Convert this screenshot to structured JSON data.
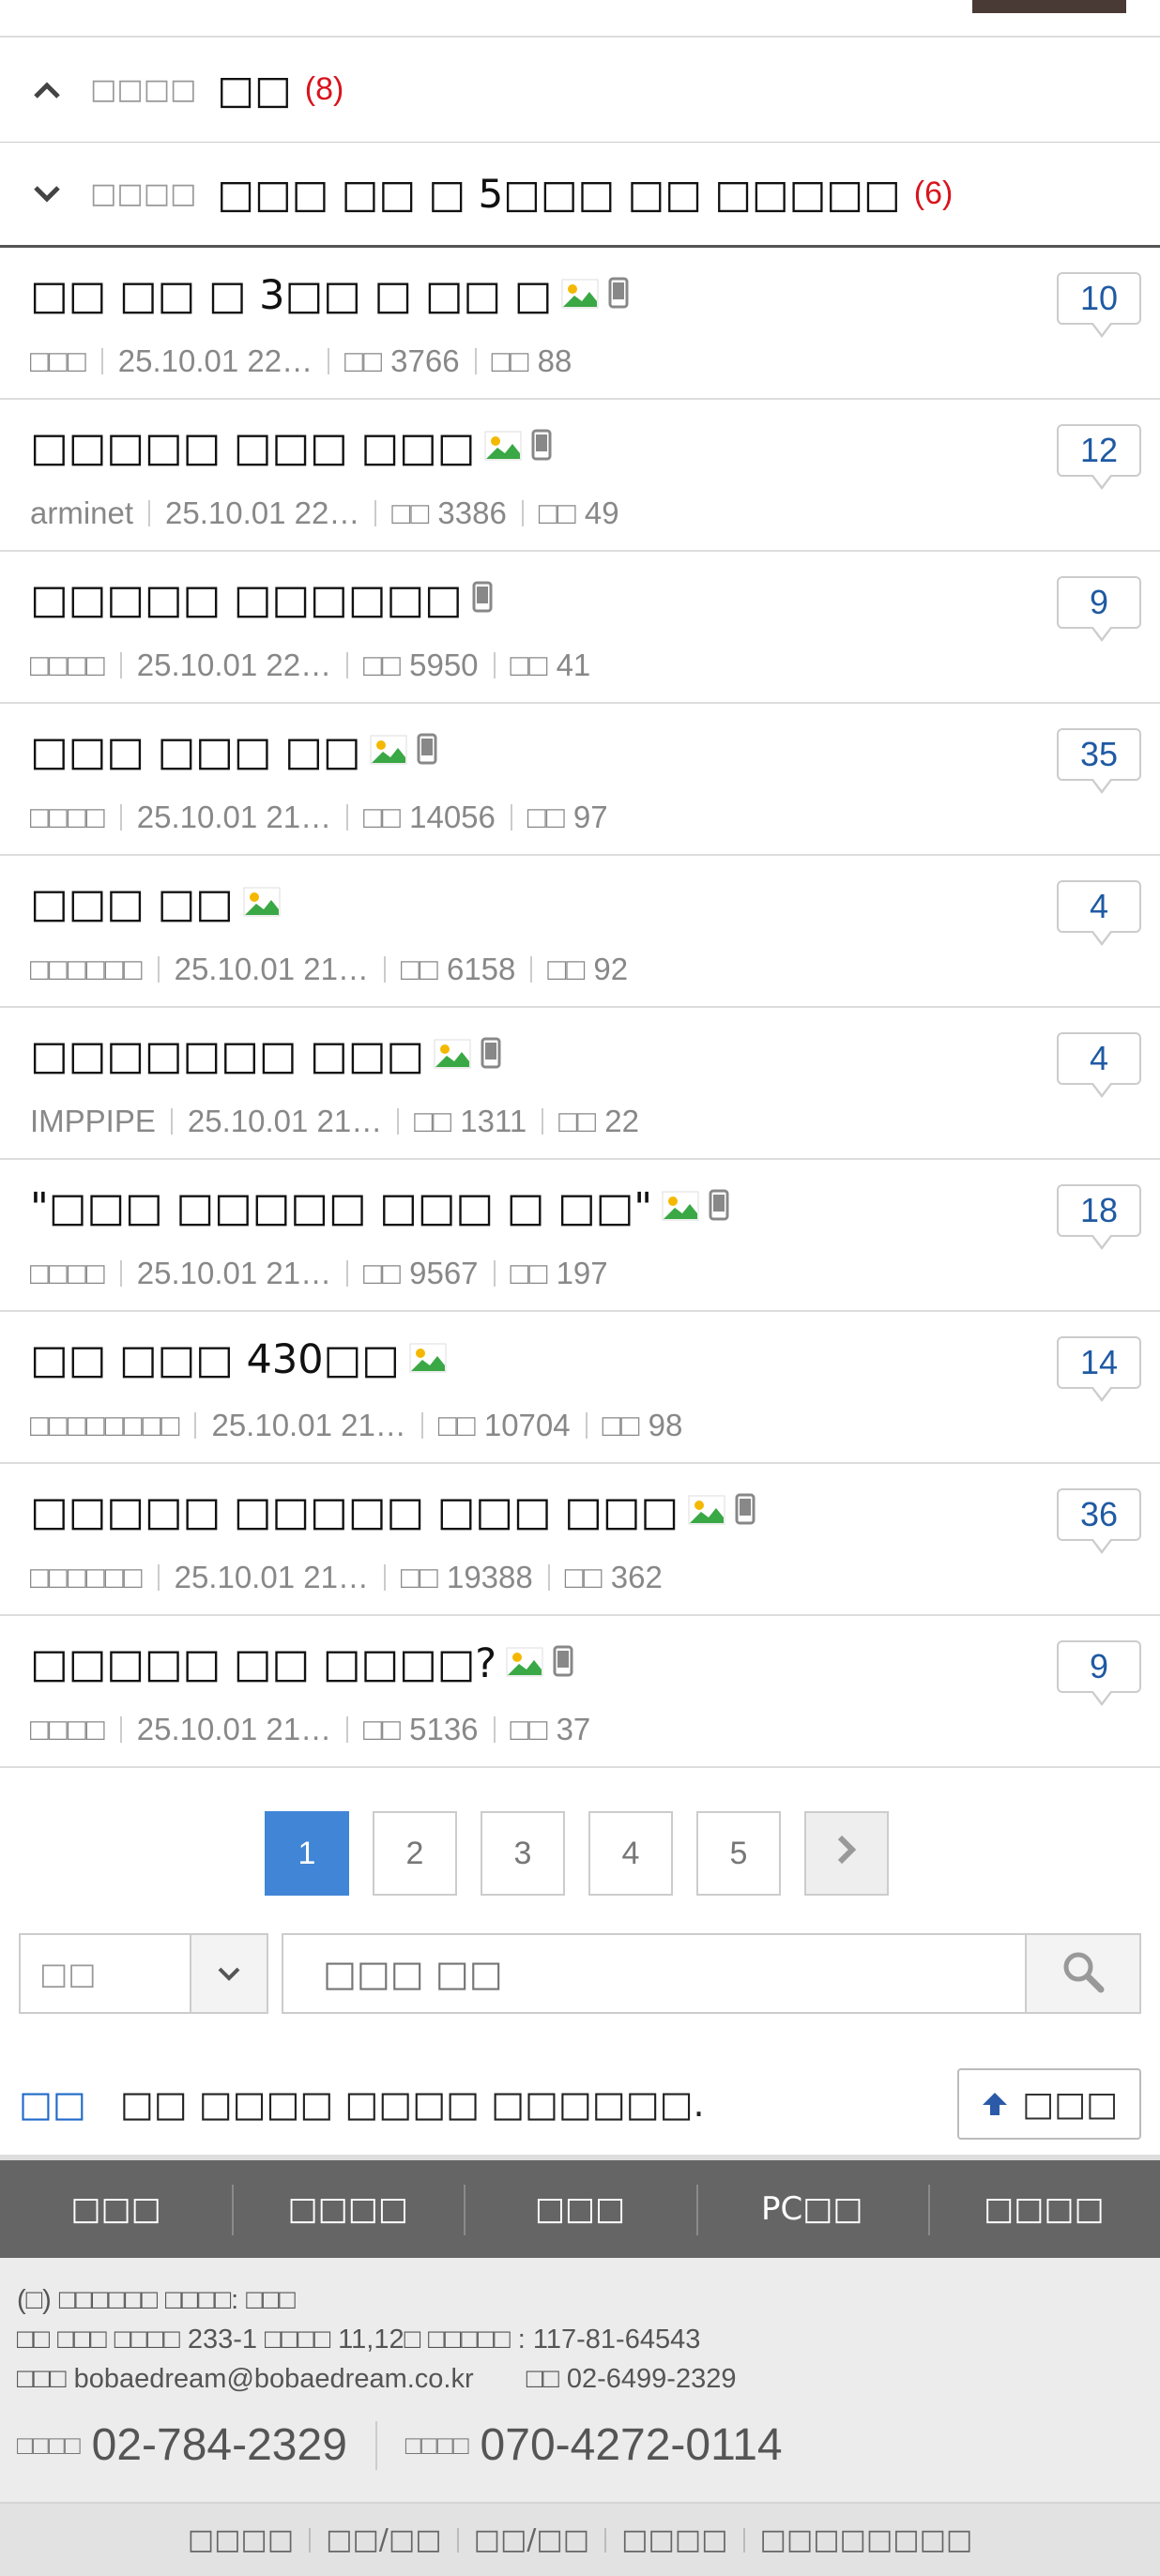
{
  "reply_rows": [
    {
      "meta": "□□□□",
      "title": "□□",
      "count": "(8)",
      "expanded": true
    },
    {
      "meta": "□□□□",
      "title": "□□□ □□ □ 5□□□ □□ □□□□□",
      "count": "(6)",
      "expanded": false
    }
  ],
  "posts": [
    {
      "title": "□□ □□ □ 3□□ □ □□ □",
      "image": true,
      "mobile": true,
      "author": "□□□",
      "date": "25.10.01  22…",
      "views": "□□ 3766",
      "likes": "□□ 88",
      "comments": "10"
    },
    {
      "title": "□□□□□ □□□ □□□",
      "image": true,
      "mobile": true,
      "author": "arminet",
      "date": "25.10.01  22…",
      "views": "□□ 3386",
      "likes": "□□ 49",
      "comments": "12"
    },
    {
      "title": "□□□□□ □□□□□□",
      "image": false,
      "mobile": true,
      "author": "□□□□",
      "date": "25.10.01  22…",
      "views": "□□ 5950",
      "likes": "□□ 41",
      "comments": "9"
    },
    {
      "title": "□□□ □□□ □□",
      "image": true,
      "mobile": true,
      "author": "□□□□",
      "date": "25.10.01  21…",
      "views": "□□ 14056",
      "likes": "□□ 97",
      "comments": "35"
    },
    {
      "title": "□□□ □□",
      "image": true,
      "mobile": false,
      "author": "□□□□□□",
      "date": "25.10.01  21…",
      "views": "□□ 6158",
      "likes": "□□ 92",
      "comments": "4"
    },
    {
      "title": "□□□□□□□ □□□",
      "image": true,
      "mobile": true,
      "author": "IMPPIPE",
      "date": "25.10.01  21…",
      "views": "□□ 1311",
      "likes": "□□ 22",
      "comments": "4"
    },
    {
      "title": "\"□□□ □□□□□ □□□ □ □□\"",
      "image": true,
      "mobile": true,
      "author": "□□□□",
      "date": "25.10.01  21…",
      "views": "□□ 9567",
      "likes": "□□ 197",
      "comments": "18"
    },
    {
      "title": "□□ □□□ 430□□",
      "image": true,
      "mobile": false,
      "author": "□□□□□□□□",
      "date": "25.10.01  21…",
      "views": "□□ 10704",
      "likes": "□□ 98",
      "comments": "14"
    },
    {
      "title": "□□□□□ □□□□□ □□□ □□□",
      "image": true,
      "mobile": true,
      "author": "□□□□□□",
      "date": "25.10.01  21…",
      "views": "□□ 19388",
      "likes": "□□ 362",
      "comments": "36"
    },
    {
      "title": "□□□□□ □□ □□□□?",
      "image": true,
      "mobile": true,
      "author": "□□□□",
      "date": "25.10.01  21…",
      "views": "□□ 5136",
      "likes": "□□ 37",
      "comments": "9"
    }
  ],
  "pagination": {
    "pages": [
      "1",
      "2",
      "3",
      "4",
      "5"
    ],
    "current": "1",
    "next_icon": "chevron-right-icon"
  },
  "search": {
    "select_value": "□□",
    "placeholder": "□□□ □□",
    "button_icon": "search-icon"
  },
  "notice": {
    "label": "□□",
    "text": "□□ □□□□ □□□□ □□□□□□.",
    "top_button": "□□□"
  },
  "footer_nav": [
    "□□□",
    "□□□□",
    "□□□",
    "PC□□",
    "□□□□"
  ],
  "footer_info": {
    "line1": "(□) □□□□□□ □□□□: □□□",
    "line2": "□□ □□□ □□□□ 233-1 □□□□ 11,12□ □□□□□ : 117-81-64543",
    "line3_email": "□□□ bobaedream@bobaedream.co.kr",
    "line3_fax": "□□ 02-6499-2329",
    "phone1_label": "□□□□",
    "phone1": "02-784-2329",
    "phone2_label": "□□□□",
    "phone2": "070-4272-0114"
  },
  "footer_links": [
    "□□□□",
    "□□/□□",
    "□□/□□",
    "□□□□",
    "□□□□□□□□"
  ],
  "colors": {
    "accent": "#4185d6",
    "comment_blue": "#1f5aa3",
    "count_red": "#d9141d",
    "footer_dark": "#656565"
  }
}
